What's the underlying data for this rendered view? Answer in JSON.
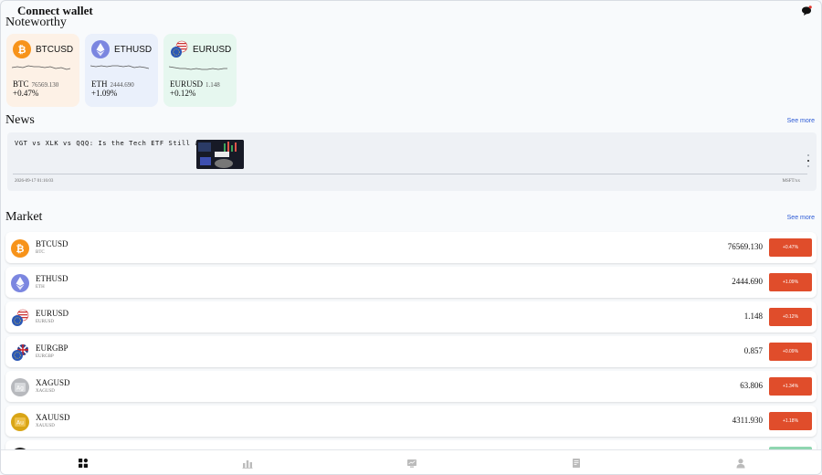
{
  "header": {
    "title": "Connect wallet",
    "chat_icon": "chat-bubble-icon"
  },
  "noteworthy": {
    "title": "Noteworthy",
    "cards": [
      {
        "symbol": "BTCUSD",
        "base": "BTC",
        "price": "76569.130",
        "change": "+0.47%",
        "bg": "#fdf1e6",
        "coin_color": "#f7931a",
        "icon": "bitcoin-icon"
      },
      {
        "symbol": "ETHUSD",
        "base": "ETH",
        "price": "2444.690",
        "change": "+1.09%",
        "bg": "#eaf0fb",
        "coin_color": "#7b86e0",
        "icon": "ethereum-icon"
      },
      {
        "symbol": "EURUSD",
        "base": "EURUSD",
        "price": "1.148",
        "change": "+0.12%",
        "bg": "#e6f7ef",
        "coin_color": "#2a57b5",
        "icon": "eurusd-flag-icon"
      }
    ]
  },
  "news": {
    "title": "News",
    "see_more": "See more",
    "headline": "VGT vs XLK vs QQQ: Is the Tech ETF Still a Buy?",
    "date": "2026-09-17 01:16:03",
    "source": "MSFT/xx"
  },
  "market": {
    "title": "Market",
    "see_more": "See more",
    "rows": [
      {
        "name": "BTCUSD",
        "sub": "BTC",
        "price": "76569.130",
        "change": "+0.47%",
        "icon": "bitcoin-icon"
      },
      {
        "name": "ETHUSD",
        "sub": "ETH",
        "price": "2444.690",
        "change": "+1.09%",
        "icon": "ethereum-icon"
      },
      {
        "name": "EURUSD",
        "sub": "EURUSD",
        "price": "1.148",
        "change": "+0.12%",
        "icon": "eurusd-flag-icon"
      },
      {
        "name": "EURGBP",
        "sub": "EURGBP",
        "price": "0.857",
        "change": "+0.09%",
        "icon": "eurgbp-flag-icon"
      },
      {
        "name": "XAGUSD",
        "sub": "XAGUSD",
        "price": "63.806",
        "change": "+1.34%",
        "icon": "silver-icon"
      },
      {
        "name": "XAUUSD",
        "sub": "XAUUSD",
        "price": "4311.930",
        "change": "+1.18%",
        "icon": "gold-icon"
      }
    ]
  },
  "bottom_nav": [
    {
      "icon": "home-icon",
      "active": true
    },
    {
      "icon": "markets-icon",
      "active": false
    },
    {
      "icon": "trade-icon",
      "active": false
    },
    {
      "icon": "orders-icon",
      "active": false
    },
    {
      "icon": "profile-icon",
      "active": false
    }
  ]
}
